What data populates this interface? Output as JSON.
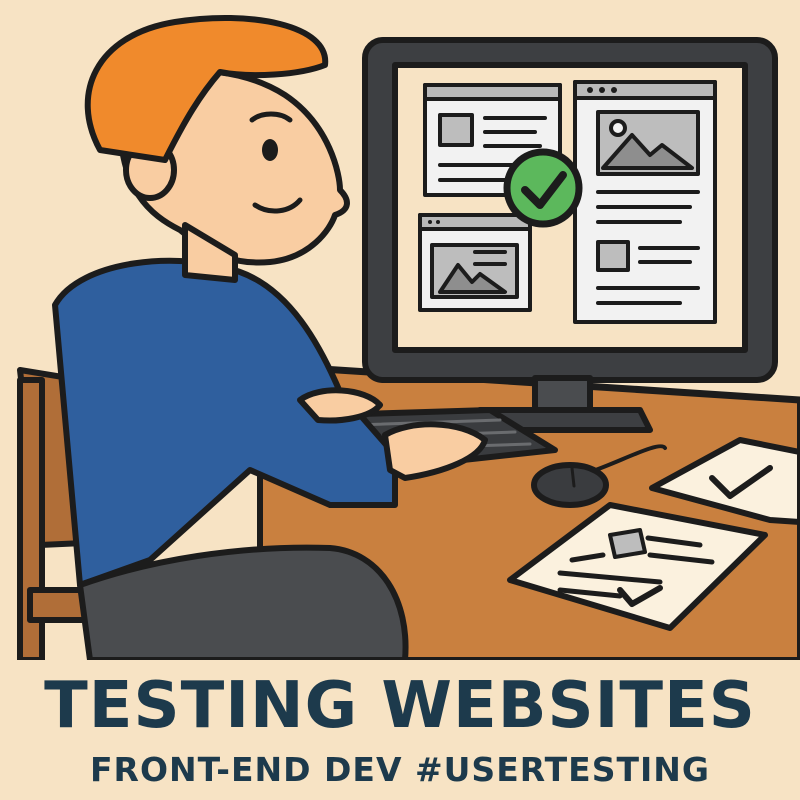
{
  "caption": {
    "title": "TESTING WEBSITES",
    "subtitle": "FRONT-END DEV #USERTESTING"
  },
  "scene": {
    "icons": [
      "check-circle-icon",
      "image-placeholder-icon",
      "checkmark-icon"
    ]
  },
  "colors": {
    "background": "#f7e3c4",
    "shirt": "#2f5f9e",
    "hair": "#f08a2c",
    "skin": "#f9cda2",
    "desk": "#c9803f",
    "check_green": "#5cb85c",
    "text_navy": "#1d3a4c"
  }
}
